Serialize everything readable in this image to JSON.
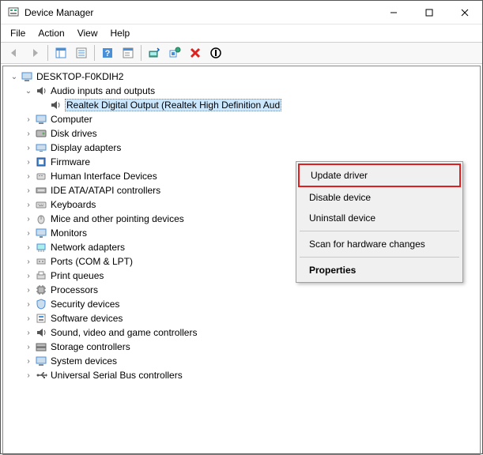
{
  "window": {
    "title": "Device Manager"
  },
  "menu": {
    "file": "File",
    "action": "Action",
    "view": "View",
    "help": "Help"
  },
  "tree": {
    "root": "DESKTOP-F0KDIH2",
    "audio_category": "Audio inputs and outputs",
    "audio_item": "Realtek Digital Output (Realtek High Definition Aud",
    "categories": [
      "Computer",
      "Disk drives",
      "Display adapters",
      "Firmware",
      "Human Interface Devices",
      "IDE ATA/ATAPI controllers",
      "Keyboards",
      "Mice and other pointing devices",
      "Monitors",
      "Network adapters",
      "Ports (COM & LPT)",
      "Print queues",
      "Processors",
      "Security devices",
      "Software devices",
      "Sound, video and game controllers",
      "Storage controllers",
      "System devices",
      "Universal Serial Bus controllers"
    ]
  },
  "context_menu": {
    "update": "Update driver",
    "disable": "Disable device",
    "uninstall": "Uninstall device",
    "scan": "Scan for hardware changes",
    "properties": "Properties"
  }
}
